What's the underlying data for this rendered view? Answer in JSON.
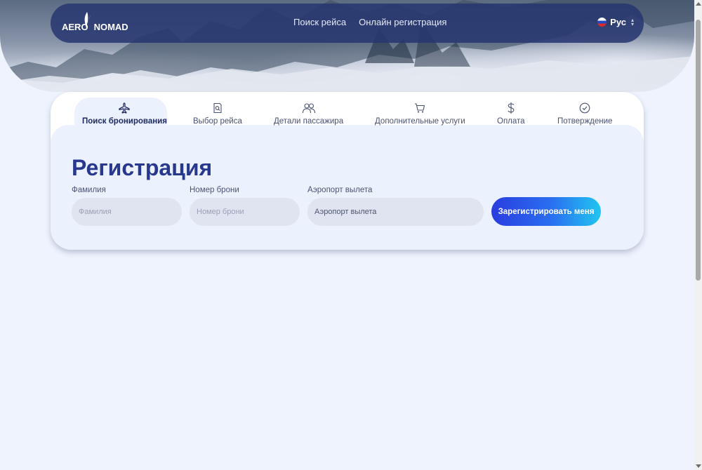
{
  "brand": {
    "logo_part1": "AERO",
    "logo_part2": "NOMAD"
  },
  "nav": {
    "links": [
      "Поиск рейса",
      "Онлайн регистрация"
    ],
    "language": "Рус"
  },
  "steps": [
    {
      "label": "Поиск бронирования",
      "icon": "plane-icon",
      "active": true
    },
    {
      "label": "Выбор рейса",
      "icon": "document-search-icon",
      "active": false
    },
    {
      "label": "Детали пассажира",
      "icon": "passengers-icon",
      "active": false
    },
    {
      "label": "Дополнительные услуги",
      "icon": "cart-icon",
      "active": false
    },
    {
      "label": "Оплата",
      "icon": "dollar-icon",
      "active": false
    },
    {
      "label": "Потверждение",
      "icon": "check-circle-icon",
      "active": false
    }
  ],
  "form": {
    "title": "Регистрация",
    "surname": {
      "label": "Фамилия",
      "placeholder": "Фамилия"
    },
    "booking": {
      "label": "Номер брони",
      "placeholder": "Номер брони"
    },
    "airport": {
      "label": "Аэропорт вылета",
      "placeholder": "Аэропорт вылета"
    },
    "submit_label": "Зарегистрировать меня"
  },
  "colors": {
    "navbar": "#263570",
    "title": "#28388e",
    "background": "#eef3fe",
    "button_gradient": [
      "#2a3de0",
      "#21c6f0"
    ]
  }
}
